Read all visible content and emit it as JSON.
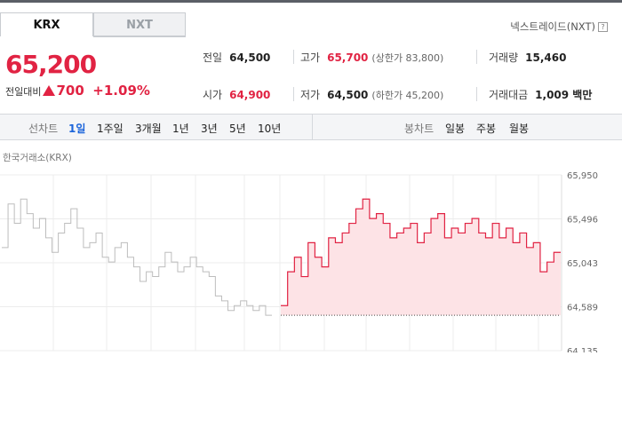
{
  "tabs": [
    {
      "label": "KRX",
      "active": true
    },
    {
      "label": "NXT",
      "active": false
    }
  ],
  "nxt_link": "넥스트레이드(NXT)",
  "nxt_help": "?",
  "quote": {
    "price": "65,200",
    "change_label": "전일대비",
    "change_value": "700",
    "change_pct": "+1.09%",
    "direction": "up"
  },
  "stats": {
    "prev_close": {
      "label": "전일",
      "value": "64,500"
    },
    "high": {
      "label": "고가",
      "value": "65,700",
      "sub": "(상한가 83,800)"
    },
    "volume": {
      "label": "거래량",
      "value": "15,460"
    },
    "open": {
      "label": "시가",
      "value": "64,900"
    },
    "low": {
      "label": "저가",
      "value": "64,500",
      "sub": "(하한가 45,200)"
    },
    "amount": {
      "label": "거래대금",
      "value": "1,009 백만"
    }
  },
  "toolbar": {
    "line_label": "선차트",
    "line_ranges": [
      "1일",
      "1주일",
      "3개월",
      "1년",
      "3년",
      "5년",
      "10년"
    ],
    "active_range": "1일",
    "candle_label": "봉차트",
    "candle_ranges": [
      "일봉",
      "주봉",
      "월봉"
    ]
  },
  "colors": {
    "up": "#e12343",
    "accent": "#1b64da",
    "gray_line": "#bdbdbd"
  },
  "chart_data": {
    "type": "line",
    "title": "한국거래소(KRX)",
    "y_ticks": [
      "65,950",
      "65,496",
      "65,043",
      "64,589",
      "64,135"
    ],
    "ylim": [
      64135,
      65950
    ],
    "baseline": 64500,
    "grid": true,
    "series": [
      {
        "session": "previous",
        "color": "gray",
        "values": [
          65200,
          65650,
          65450,
          65700,
          65550,
          65400,
          65500,
          65300,
          65150,
          65350,
          65450,
          65600,
          65400,
          65200,
          65250,
          65350,
          65100,
          65050,
          65200,
          65250,
          65100,
          65000,
          64850,
          64950,
          64900,
          65000,
          65150,
          65050,
          64950,
          65000,
          65100,
          65000,
          64950,
          64900,
          64700,
          64650,
          64550,
          64600,
          64650,
          64600,
          64550,
          64600,
          64500
        ]
      },
      {
        "session": "current",
        "color": "red",
        "values": [
          64600,
          64950,
          65100,
          64900,
          65250,
          65100,
          65000,
          65300,
          65250,
          65350,
          65450,
          65600,
          65700,
          65500,
          65550,
          65450,
          65300,
          65350,
          65400,
          65450,
          65250,
          65350,
          65500,
          65550,
          65300,
          65400,
          65350,
          65450,
          65500,
          65350,
          65300,
          65450,
          65300,
          65400,
          65250,
          65350,
          65200,
          65250,
          64950,
          65050,
          65150
        ]
      }
    ]
  }
}
